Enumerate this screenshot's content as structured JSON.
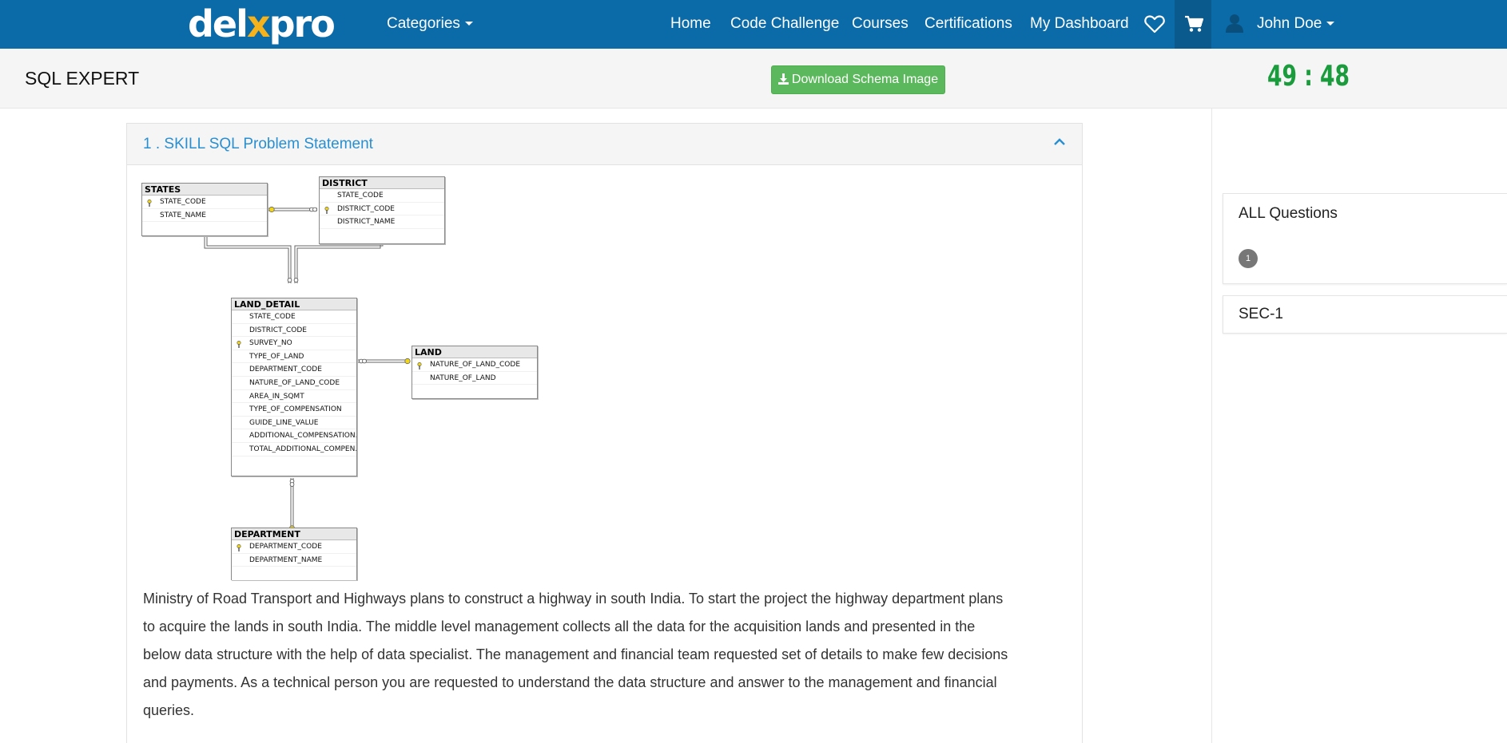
{
  "nav": {
    "logo_left": "del",
    "logo_x": "x",
    "logo_right": "pro",
    "categories": "Categories",
    "links": [
      "Home",
      "Code Challenge",
      "Courses",
      "Certifications",
      "My Dashboard"
    ],
    "user_name": "John Doe"
  },
  "subheader": {
    "title": "SQL EXPERT",
    "download_label": "Download Schema Image",
    "timer": "49 : 48"
  },
  "panel": {
    "title": "1 . SKILL SQL Problem Statement",
    "description": "Ministry of Road Transport and Highways plans to construct a highway in south India. To start the project the highway department plans to acquire the lands in south India. The middle level management collects all the data for the acquisition lands and presented in the below data structure with the help of data specialist. The management and financial team requested set of details to make few decisions and payments. As a technical person you are requested to understand the data structure and answer to the management and financial queries."
  },
  "schema": {
    "states": {
      "name": "STATES",
      "columns": [
        "STATE_CODE",
        "STATE_NAME"
      ],
      "keys": [
        0
      ]
    },
    "district": {
      "name": "DISTRICT",
      "columns": [
        "STATE_CODE",
        "DISTRICT_CODE",
        "DISTRICT_NAME"
      ],
      "keys": [
        1
      ]
    },
    "land_detail": {
      "name": "LAND_DETAIL",
      "columns": [
        "STATE_CODE",
        "DISTRICT_CODE",
        "SURVEY_NO",
        "TYPE_OF_LAND",
        "DEPARTMENT_CODE",
        "NATURE_OF_LAND_CODE",
        "AREA_IN_SQMT",
        "TYPE_OF_COMPENSATION",
        "GUIDE_LINE_VALUE",
        "ADDITIONAL_COMPENSATION...",
        "TOTAL_ADDITIONAL_COMPEN..."
      ],
      "keys": [
        2
      ]
    },
    "land": {
      "name": "LAND",
      "columns": [
        "NATURE_OF_LAND_CODE",
        "NATURE_OF_LAND"
      ],
      "keys": [
        0
      ]
    },
    "department": {
      "name": "DEPARTMENT",
      "columns": [
        "DEPARTMENT_CODE",
        "DEPARTMENT_NAME"
      ],
      "keys": [
        0
      ]
    }
  },
  "sidebar": {
    "all_questions": "ALL Questions",
    "question_number": "1",
    "section": "SEC-1"
  },
  "colors": {
    "nav_bg": "#0b6ba8",
    "accent_green": "#5cb85c",
    "timer_green": "#1a9c3c",
    "link_blue": "#2a8fd0"
  }
}
